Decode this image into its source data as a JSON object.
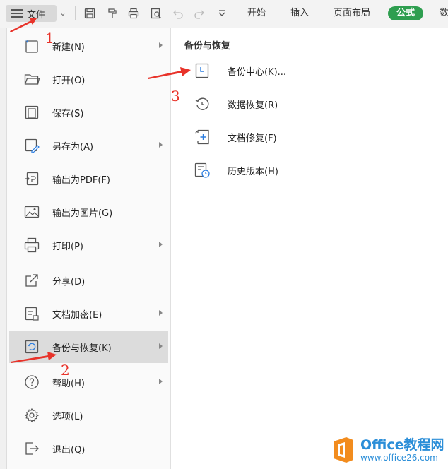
{
  "toolbar": {
    "file_label": "文件",
    "tabs": [
      "开始",
      "插入",
      "页面布局",
      "公式",
      "数"
    ],
    "icons": [
      "save-icon",
      "format-painter-icon",
      "print-icon",
      "print-preview-icon",
      "undo-icon",
      "redo-icon",
      "more-icon"
    ]
  },
  "file_menu": {
    "items": [
      {
        "label": "新建(N)",
        "icon": "new-doc-icon",
        "submenu": true
      },
      {
        "label": "打开(O)",
        "icon": "folder-icon",
        "submenu": false
      },
      {
        "label": "保存(S)",
        "icon": "save-icon",
        "submenu": false
      },
      {
        "label": "另存为(A)",
        "icon": "save-as-icon",
        "submenu": true
      },
      {
        "label": "输出为PDF(F)",
        "icon": "pdf-icon",
        "submenu": false
      },
      {
        "label": "输出为图片(G)",
        "icon": "image-icon",
        "submenu": false
      },
      {
        "label": "打印(P)",
        "icon": "printer-icon",
        "submenu": true
      },
      {
        "label": "分享(D)",
        "icon": "share-icon",
        "submenu": false
      },
      {
        "label": "文档加密(E)",
        "icon": "encrypt-icon",
        "submenu": true
      },
      {
        "label": "备份与恢复(K)",
        "icon": "backup-icon",
        "submenu": true,
        "active": true
      },
      {
        "label": "帮助(H)",
        "icon": "help-icon",
        "submenu": true
      },
      {
        "label": "选项(L)",
        "icon": "gear-icon",
        "submenu": false
      },
      {
        "label": "退出(Q)",
        "icon": "exit-icon",
        "submenu": false
      }
    ]
  },
  "backup_panel": {
    "title": "备份与恢复",
    "items": [
      {
        "label": "备份中心(K)...",
        "icon": "backup-center-icon"
      },
      {
        "label": "数据恢复(R)",
        "icon": "data-recovery-icon"
      },
      {
        "label": "文档修复(F)",
        "icon": "doc-repair-icon"
      },
      {
        "label": "历史版本(H)",
        "icon": "history-icon"
      }
    ]
  },
  "annotations": {
    "numbers": [
      "1",
      "2",
      "3"
    ],
    "color": "#e8332a"
  },
  "watermark": {
    "line1": "Office教程网",
    "line2": "www.office26.com",
    "color": "#2b8ed8",
    "mark_color": "#f28c1e"
  },
  "colors": {
    "accent_tab": "#2e9e4f",
    "active_item": "#dcdcdc"
  }
}
